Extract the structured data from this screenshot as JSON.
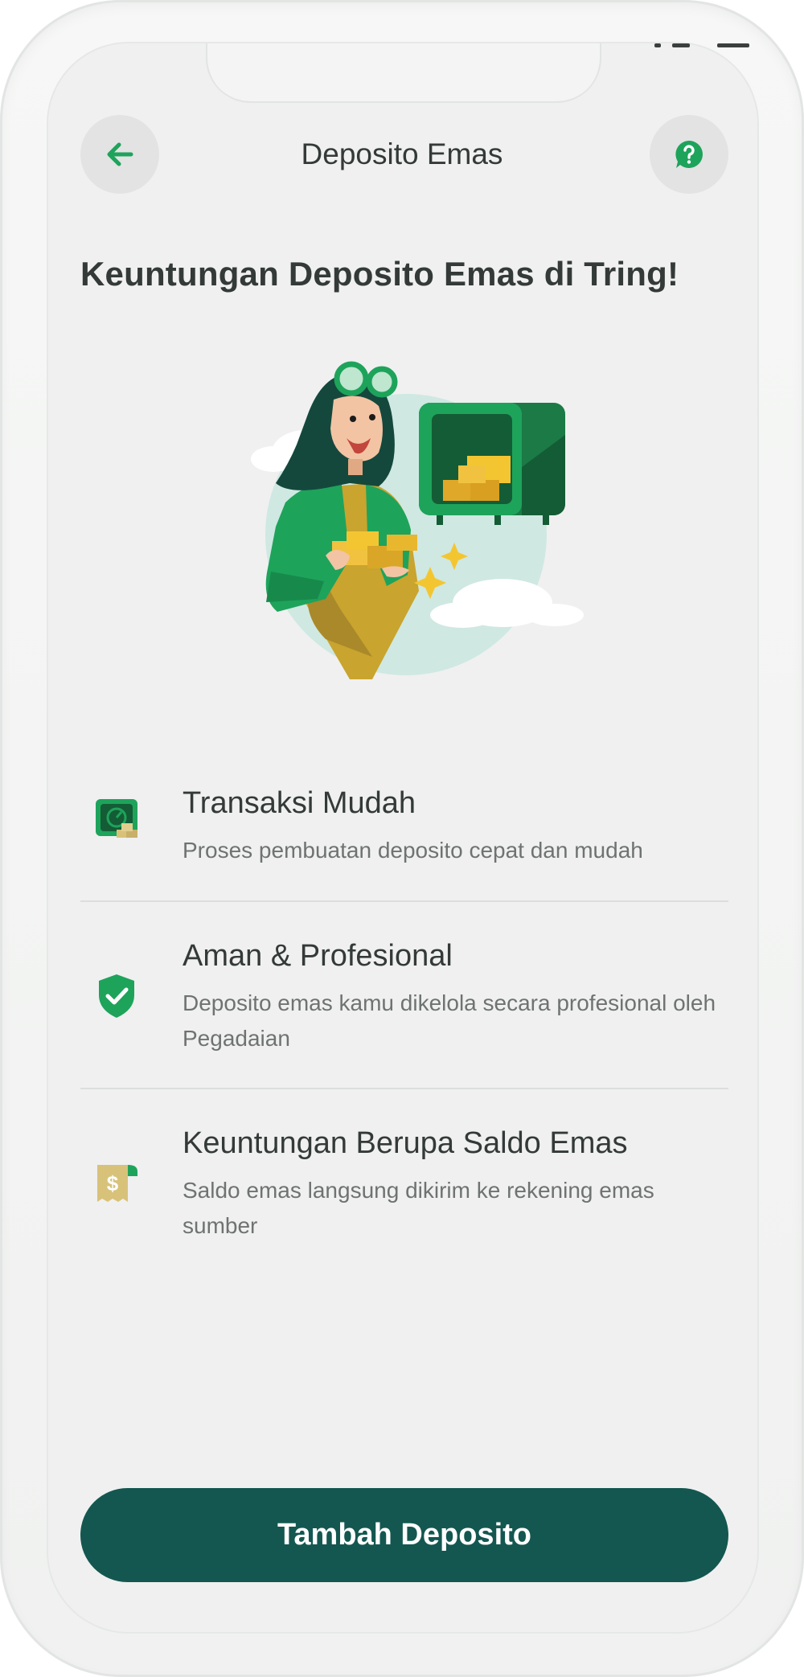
{
  "header": {
    "title": "Deposito Emas",
    "back_icon": "arrow-left-icon",
    "help_icon": "help-chat-icon"
  },
  "headline": "Keuntungan Deposito Emas di Tring!",
  "illustration": "woman-with-gold-bars-and-safe-illustration",
  "features": [
    {
      "icon": "gold-safe-icon",
      "title": "Transaksi Mudah",
      "description": "Proses pembuatan deposito cepat dan mudah"
    },
    {
      "icon": "shield-check-icon",
      "title": "Aman & Profesional",
      "description": "Deposito emas kamu dikelola secara profesional oleh Pegadaian"
    },
    {
      "icon": "dollar-receipt-icon",
      "title": "Keuntungan Berupa Saldo Emas",
      "description": "Saldo emas langsung dikirim ke rekening emas sumber"
    }
  ],
  "cta": {
    "label": "Tambah Deposito"
  },
  "colors": {
    "brand_green": "#1ea35b",
    "cta_teal": "#135750",
    "gold": "#d8c27a",
    "text_dark": "#333a38",
    "text_muted": "#6e7371",
    "screen_bg": "#f0f0f0"
  }
}
